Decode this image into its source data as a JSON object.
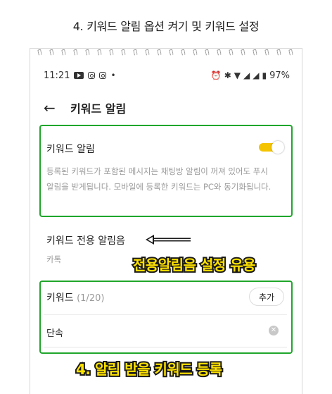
{
  "page_title": "4. 키워드 알림 옵션 켜기 및 키워드 설정",
  "status_bar": {
    "time": "11:21",
    "dot": "•",
    "battery": "97%"
  },
  "header": {
    "back_icon": "back-arrow-icon",
    "title": "키워드 알림"
  },
  "keyword_alert": {
    "label": "키워드 알림",
    "toggle_on": true,
    "toggle_color": "#f5c400",
    "description": "등록된 키워드가 포함된 메시지는 채팅방 알림이 꺼져 있어도 푸시 알림을 받게됩니다. 모바일에 등록한 키워드는 PC와 동기화됩니다."
  },
  "sound": {
    "label": "키워드 전용 알림음",
    "value": "카톡"
  },
  "keywords": {
    "label": "키워드",
    "count": "(1/20)",
    "add_label": "추가",
    "items": [
      "단속"
    ]
  },
  "annotations": {
    "sound_note": "전용알림음 설정 유용",
    "keyword_note": "4. 알림 받을 키워드 등록"
  },
  "colors": {
    "highlight_border": "#1fa62b",
    "annotation_fill": "#ffe200"
  }
}
